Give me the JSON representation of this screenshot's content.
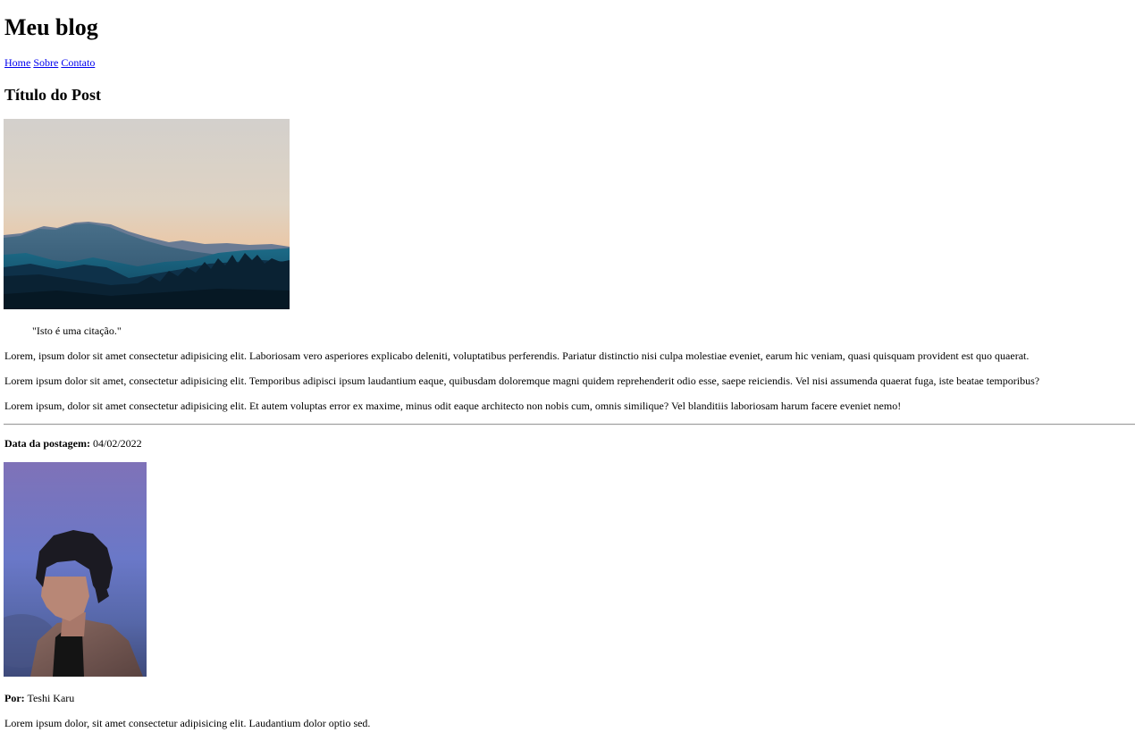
{
  "header": {
    "title": "Meu blog"
  },
  "nav": {
    "items": [
      {
        "label": "Home"
      },
      {
        "label": "Sobre"
      },
      {
        "label": "Contato"
      }
    ]
  },
  "post": {
    "title": "Título do Post",
    "image_icon": "mountain-landscape-photo",
    "quote": "\"Isto é uma citação.\"",
    "paragraphs": [
      "Lorem, ipsum dolor sit amet consectetur adipisicing elit. Laboriosam vero asperiores explicabo deleniti, voluptatibus perferendis. Pariatur distinctio nisi culpa molestiae eveniet, earum hic veniam, quasi quisquam provident est quo quaerat.",
      "Lorem ipsum dolor sit amet, consectetur adipisicing elit. Temporibus adipisci ipsum laudantium eaque, quibusdam doloremque magni quidem reprehenderit odio esse, saepe reiciendis. Vel nisi assumenda quaerat fuga, iste beatae temporibus?",
      "Lorem ipsum, dolor sit amet consectetur adipisicing elit. Et autem voluptas error ex maxime, minus odit eaque architecto non nobis cum, omnis similique? Vel blanditiis laboriosam harum facere eveniet nemo!"
    ],
    "date_label": "Data da postagem:",
    "date_value": "04/02/2022"
  },
  "author": {
    "photo_icon": "author-portrait-photo",
    "by_label": "Por:",
    "name": "Teshi Karu",
    "bio": "Lorem ipsum dolor, sit amet consectetur adipisicing elit. Laudantium dolor optio sed."
  },
  "colors": {
    "link": "#0000ee",
    "text": "#000000",
    "background": "#ffffff"
  }
}
